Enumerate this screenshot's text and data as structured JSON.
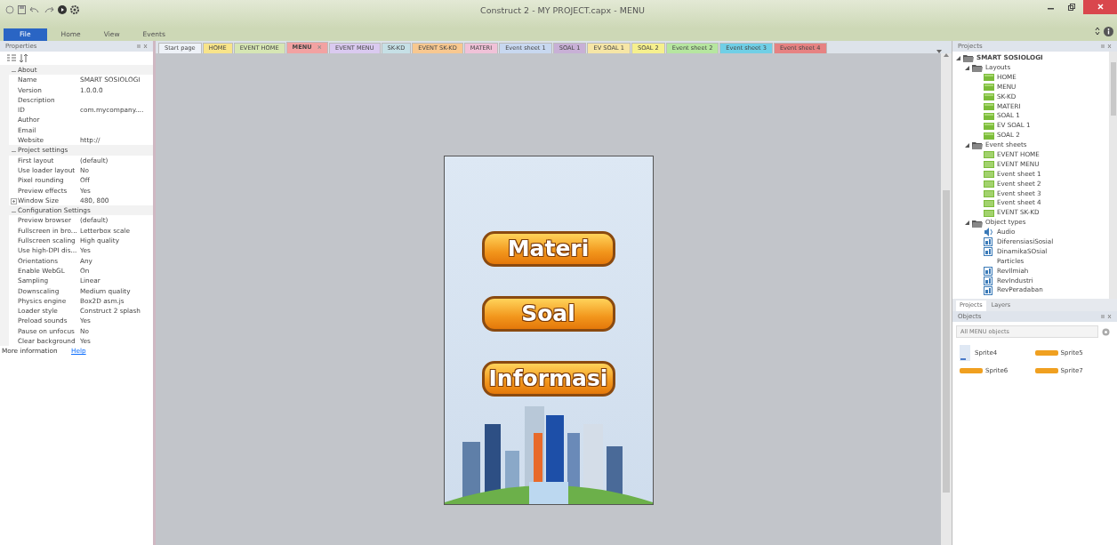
{
  "window": {
    "title": "Construct 2 - MY PROJECT.capx - MENU"
  },
  "ribbon": {
    "tabs": [
      {
        "label": "File",
        "selected": true
      },
      {
        "label": "Home",
        "selected": false
      },
      {
        "label": "View",
        "selected": false
      },
      {
        "label": "Events",
        "selected": false
      }
    ]
  },
  "properties": {
    "title": "Properties",
    "rows": [
      {
        "kind": "group",
        "label": "About",
        "expanded": true
      },
      {
        "kind": "prop",
        "label": "Name",
        "value": "SMART SOSIOLOGI"
      },
      {
        "kind": "prop",
        "label": "Version",
        "value": "1.0.0.0"
      },
      {
        "kind": "prop",
        "label": "Description"
      },
      {
        "kind": "prop",
        "label": "ID",
        "value": "com.mycompany...."
      },
      {
        "kind": "prop",
        "label": "Author"
      },
      {
        "kind": "prop",
        "label": "Email"
      },
      {
        "kind": "prop",
        "label": "Website",
        "value": "http://"
      },
      {
        "kind": "group",
        "label": "Project settings",
        "expanded": true
      },
      {
        "kind": "prop",
        "label": "First layout",
        "value": "(default)"
      },
      {
        "kind": "prop",
        "label": "Use loader layout",
        "value": "No"
      },
      {
        "kind": "prop",
        "label": "Pixel rounding",
        "value": "Off"
      },
      {
        "kind": "prop",
        "label": "Preview effects",
        "value": "Yes"
      },
      {
        "kind": "prop",
        "label": "Window Size",
        "value": "480, 800",
        "expanded": false
      },
      {
        "kind": "group",
        "label": "Configuration Settings",
        "expanded": true
      },
      {
        "kind": "prop",
        "label": "Preview browser",
        "value": "(default)"
      },
      {
        "kind": "prop",
        "label": "Fullscreen in bro...",
        "value": "Letterbox scale"
      },
      {
        "kind": "prop",
        "label": "Fullscreen scaling",
        "value": "High quality"
      },
      {
        "kind": "prop",
        "label": "Use high-DPI dis...",
        "value": "Yes"
      },
      {
        "kind": "prop",
        "label": "Orientations",
        "value": "Any"
      },
      {
        "kind": "prop",
        "label": "Enable WebGL",
        "value": "On"
      },
      {
        "kind": "prop",
        "label": "Sampling",
        "value": "Linear"
      },
      {
        "kind": "prop",
        "label": "Downscaling",
        "value": "Medium quality"
      },
      {
        "kind": "prop",
        "label": "Physics engine",
        "value": "Box2D asm.js"
      },
      {
        "kind": "prop",
        "label": "Loader style",
        "value": "Construct 2 splash"
      },
      {
        "kind": "prop",
        "label": "Preload sounds",
        "value": "Yes"
      },
      {
        "kind": "prop",
        "label": "Pause on unfocus",
        "value": "No"
      },
      {
        "kind": "prop",
        "label": "Clear background",
        "value": "Yes"
      }
    ],
    "more": {
      "label": "More information",
      "link": "Help"
    }
  },
  "tabs": [
    {
      "label": "Start page",
      "color": "#eef2f8",
      "selected": false
    },
    {
      "label": "HOME",
      "color": "#f8e48a",
      "selected": false
    },
    {
      "label": "EVENT HOME",
      "color": "#d6e6b4",
      "selected": false
    },
    {
      "label": "MENU",
      "color": "#f2a2a2",
      "selected": true,
      "close": "×"
    },
    {
      "label": "EVENT MENU",
      "color": "#dacaf0",
      "selected": false
    },
    {
      "label": "SK-KD",
      "color": "#c6e0e6",
      "selected": false
    },
    {
      "label": "EVENT SK-KD",
      "color": "#f8c890",
      "selected": false
    },
    {
      "label": "MATERI",
      "color": "#f0c2d8",
      "selected": false
    },
    {
      "label": "Event sheet 1",
      "color": "#c8d8f0",
      "selected": false
    },
    {
      "label": "SOAL 1",
      "color": "#c8b0d6",
      "selected": false
    },
    {
      "label": "EV SOAL 1",
      "color": "#f6e6a6",
      "selected": false
    },
    {
      "label": "SOAL 2",
      "color": "#f6f08e",
      "selected": false
    },
    {
      "label": "Event sheet 2",
      "color": "#b6e6a0",
      "selected": false
    },
    {
      "label": "Event sheet 3",
      "color": "#70cfe6",
      "selected": false
    },
    {
      "label": "Event sheet 4",
      "color": "#e68282",
      "selected": false
    }
  ],
  "layout": {
    "buttons": [
      "Materi",
      "Soal",
      "Informasi"
    ]
  },
  "projects": {
    "title": "Projects",
    "tree": [
      {
        "label": "SMART SOSIOLOGI",
        "kind": "folder",
        "expanded": true,
        "children": [
          {
            "label": "Layouts",
            "kind": "folder",
            "expanded": true,
            "children": [
              {
                "label": "HOME",
                "kind": "layout"
              },
              {
                "label": "MENU",
                "kind": "layout"
              },
              {
                "label": "SK-KD",
                "kind": "layout"
              },
              {
                "label": "MATERI",
                "kind": "layout"
              },
              {
                "label": "SOAL 1",
                "kind": "layout"
              },
              {
                "label": "EV SOAL 1",
                "kind": "layout"
              },
              {
                "label": "SOAL 2",
                "kind": "layout"
              }
            ]
          },
          {
            "label": "Event sheets",
            "kind": "folder",
            "expanded": true,
            "children": [
              {
                "label": "EVENT HOME",
                "kind": "sheet"
              },
              {
                "label": "EVENT MENU",
                "kind": "sheet"
              },
              {
                "label": "Event sheet 1",
                "kind": "sheet"
              },
              {
                "label": "Event sheet 2",
                "kind": "sheet"
              },
              {
                "label": "Event sheet 3",
                "kind": "sheet"
              },
              {
                "label": "Event sheet 4",
                "kind": "sheet"
              },
              {
                "label": "EVENT SK-KD",
                "kind": "sheet"
              }
            ]
          },
          {
            "label": "Object types",
            "kind": "folder",
            "expanded": true,
            "children": [
              {
                "label": "Audio",
                "kind": "audio"
              },
              {
                "label": "DiferensiasiSosial",
                "kind": "sprite"
              },
              {
                "label": "DinamikaSOsial",
                "kind": "sprite"
              },
              {
                "label": "Particles",
                "kind": "plain"
              },
              {
                "label": "RevIlmiah",
                "kind": "sprite"
              },
              {
                "label": "RevIndustri",
                "kind": "sprite"
              },
              {
                "label": "RevPeradaban",
                "kind": "sprite"
              }
            ]
          }
        ]
      }
    ],
    "bottom_tabs": [
      {
        "label": "Projects",
        "selected": true
      },
      {
        "label": "Layers",
        "selected": false
      }
    ]
  },
  "objects": {
    "title": "Objects",
    "search": {
      "placeholder": "All MENU objects"
    },
    "items": [
      {
        "label": "Sprite4",
        "kind": "page"
      },
      {
        "label": "Sprite5",
        "kind": "bar"
      },
      {
        "label": "Sprite6",
        "kind": "bar"
      },
      {
        "label": "Sprite7",
        "kind": "bar"
      }
    ]
  }
}
